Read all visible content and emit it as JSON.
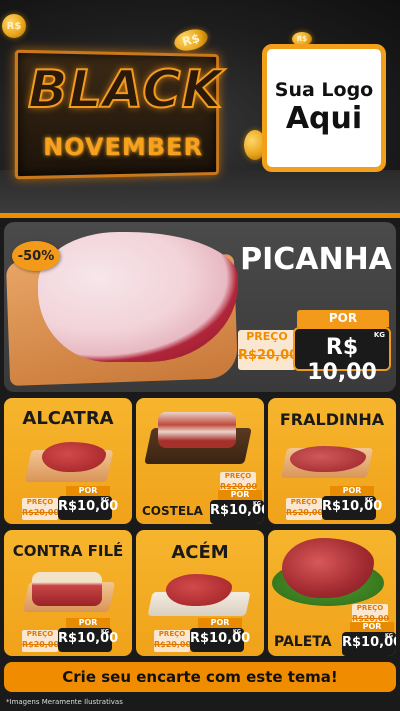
{
  "header": {
    "title_line1": "BLACK",
    "title_line2": "NOVEMBER",
    "coin_symbol": "R$",
    "logo_line1": "Sua Logo",
    "logo_line2": "Aqui"
  },
  "featured": {
    "discount": "-50%",
    "name": "PICANHA",
    "old_label": "PREÇO",
    "old_price": "R$20,00",
    "new_label": "POR",
    "new_price": "R$ 10,00",
    "unit": "KG"
  },
  "products": [
    {
      "name": "ALCATRA",
      "old_label": "PREÇO",
      "old_price": "R$20,00",
      "new_label": "POR",
      "new_price": "R$10,00",
      "unit": "KG"
    },
    {
      "name": "COSTELA",
      "old_label": "PREÇO",
      "old_price": "R$20,00",
      "new_label": "POR",
      "new_price": "R$10,00",
      "unit": "KG"
    },
    {
      "name": "FRALDINHA",
      "old_label": "PREÇO",
      "old_price": "R$20,00",
      "new_label": "POR",
      "new_price": "R$10,00",
      "unit": "KG"
    },
    {
      "name": "CONTRA FILÉ",
      "old_label": "PREÇO",
      "old_price": "R$20,00",
      "new_label": "POR",
      "new_price": "R$10,00",
      "unit": "KG"
    },
    {
      "name": "ACÉM",
      "old_label": "PREÇO",
      "old_price": "R$20,00",
      "new_label": "POR",
      "new_price": "R$10,00",
      "unit": "KG"
    },
    {
      "name": "PALETA",
      "old_label": "PREÇO",
      "old_price": "R$20,00",
      "new_label": "POR",
      "new_price": "R$10,00",
      "unit": "KG"
    }
  ],
  "cta": "Crie seu encarte com este tema!",
  "footnote": "*Imagens Meramente Ilustrativas",
  "colors": {
    "accent": "#f08c00",
    "card_yellow": "#f6b52d",
    "dark": "#1a1a1a"
  }
}
